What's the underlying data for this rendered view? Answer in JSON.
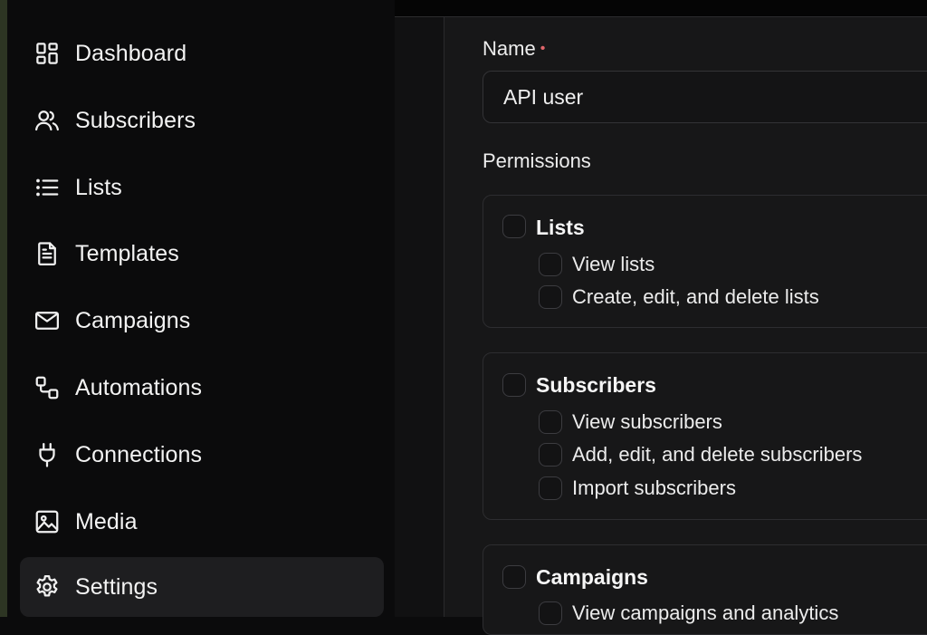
{
  "sidebar": {
    "items": [
      {
        "label": "Dashboard",
        "icon": "dashboard-grid-icon"
      },
      {
        "label": "Subscribers",
        "icon": "users-icon"
      },
      {
        "label": "Lists",
        "icon": "list-icon"
      },
      {
        "label": "Templates",
        "icon": "document-icon"
      },
      {
        "label": "Campaigns",
        "icon": "mail-icon"
      },
      {
        "label": "Automations",
        "icon": "workflow-icon"
      },
      {
        "label": "Connections",
        "icon": "plug-icon"
      },
      {
        "label": "Media",
        "icon": "image-icon"
      },
      {
        "label": "Settings",
        "icon": "gear-icon",
        "active": true
      }
    ]
  },
  "form": {
    "name_label": "Name",
    "required_marker": "•",
    "name_value": "API user",
    "permissions_label": "Permissions",
    "groups": [
      {
        "title": "Lists",
        "permissions": [
          "View lists",
          "Create, edit, and delete lists"
        ]
      },
      {
        "title": "Subscribers",
        "permissions": [
          "View subscribers",
          "Add, edit, and delete subscribers",
          "Import subscribers"
        ]
      },
      {
        "title": "Campaigns",
        "permissions": [
          "View campaigns and analytics"
        ]
      }
    ]
  },
  "colors": {
    "background": "#0b0b0c",
    "active_item": "#1e1e20",
    "panel": "#171718",
    "required": "#e0666b",
    "edge": "#2d3523"
  }
}
